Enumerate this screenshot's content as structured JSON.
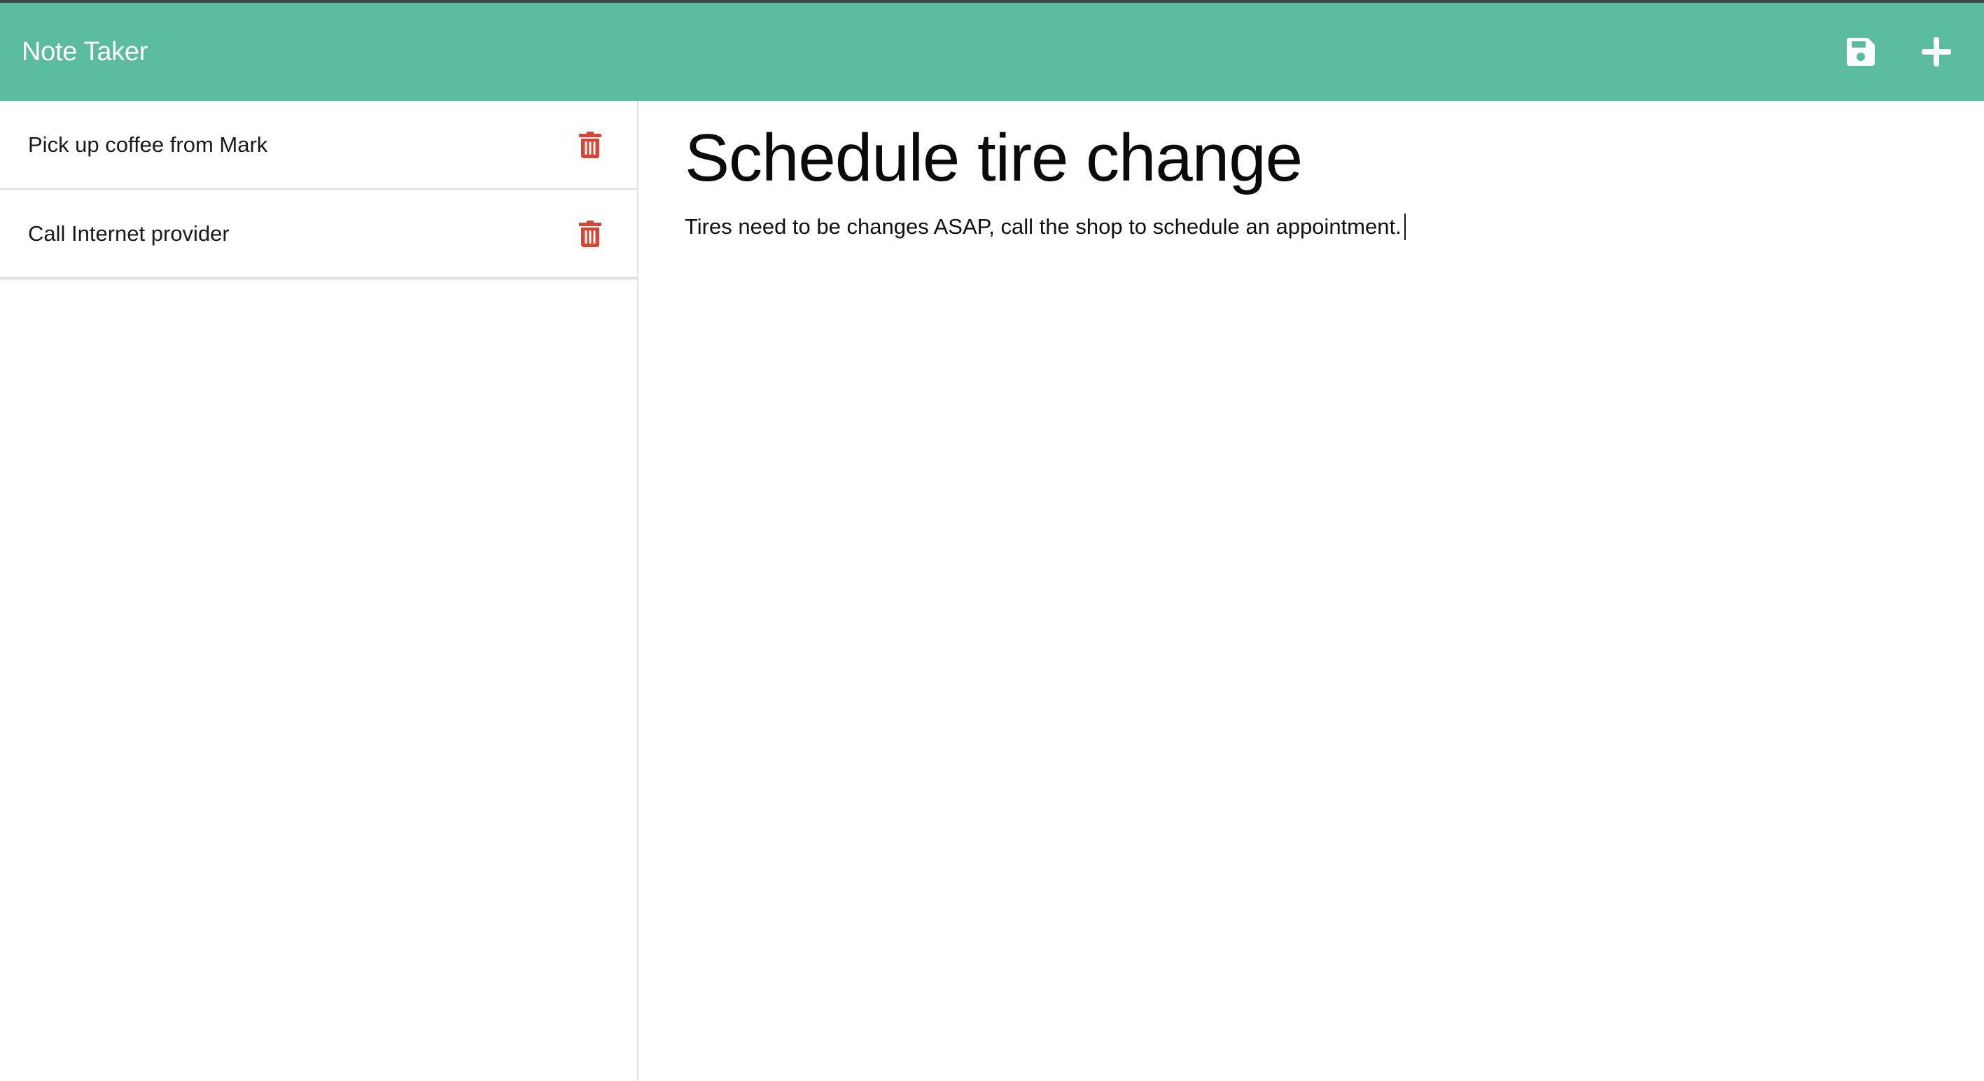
{
  "app": {
    "title": "Note Taker",
    "colors": {
      "navbar": "#5bbb9e",
      "delete": "#d64535",
      "text": "#111111"
    }
  },
  "toolbar": {
    "save_icon": "floppy-disk-icon",
    "new_icon": "plus-icon"
  },
  "notes": [
    {
      "title": "Pick up coffee from Mark",
      "delete_icon": "trash-icon"
    },
    {
      "title": "Call Internet provider",
      "delete_icon": "trash-icon"
    }
  ],
  "editor": {
    "title": "Schedule tire change",
    "body": "Tires need to be changes ASAP, call the shop to schedule an appointment."
  }
}
